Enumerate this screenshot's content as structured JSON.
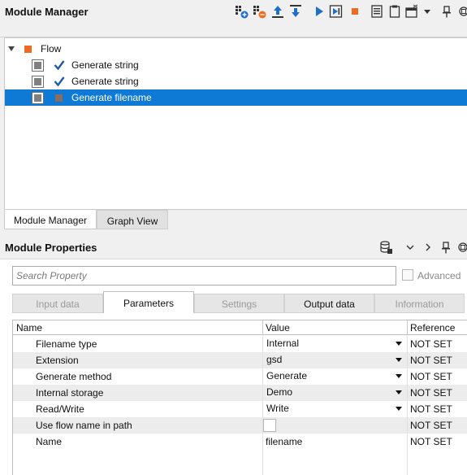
{
  "module_manager": {
    "title": "Module Manager",
    "toolbar_icons": [
      "add-module-icon",
      "remove-module-icon",
      "move-up-icon",
      "move-down-icon",
      "run-icon",
      "run-step-icon",
      "stop-icon",
      "list-icon",
      "clipboard-icon",
      "window-icon",
      "dropdown-icon",
      "pin-icon"
    ],
    "tree": {
      "root": {
        "label": "Flow",
        "color": "#ef6b22"
      },
      "items": [
        {
          "label": "Generate string",
          "status": "check"
        },
        {
          "label": "Generate string",
          "status": "check"
        },
        {
          "label": "Generate filename",
          "status": "square",
          "selected": true
        }
      ]
    },
    "tabs": [
      {
        "label": "Module Manager",
        "active": true
      },
      {
        "label": "Graph View",
        "active": false
      }
    ]
  },
  "module_properties": {
    "title": "Module Properties",
    "search": {
      "placeholder": "Search Property",
      "value": ""
    },
    "advanced_label": "Advanced",
    "tabs": [
      {
        "label": "Input data",
        "enabled": false
      },
      {
        "label": "Parameters",
        "active": true
      },
      {
        "label": "Settings",
        "enabled": false
      },
      {
        "label": "Output data",
        "enabled": true
      },
      {
        "label": "Information",
        "enabled": false
      }
    ],
    "columns": {
      "name": "Name",
      "value": "Value",
      "reference": "Reference"
    },
    "rows": [
      {
        "name": "Filename type",
        "value": "Internal",
        "dropdown": true,
        "reference": "NOT SET"
      },
      {
        "name": "Extension",
        "value": "gsd",
        "dropdown": true,
        "reference": "NOT SET"
      },
      {
        "name": "Generate method",
        "value": "Generate",
        "dropdown": true,
        "reference": "NOT SET"
      },
      {
        "name": "Internal storage",
        "value": "Demo",
        "dropdown": true,
        "reference": "NOT SET"
      },
      {
        "name": "Read/Write",
        "value": "Write",
        "dropdown": true,
        "reference": "NOT SET"
      },
      {
        "name": "Use flow name in path",
        "value": "",
        "checkbox": true,
        "reference": "NOT SET"
      },
      {
        "name": "Name",
        "value": "filename",
        "dropdown": false,
        "reference": "NOT SET"
      }
    ]
  },
  "colors": {
    "accent": "#0f7ad6",
    "flow": "#ef6b22",
    "run_blue": "#1e6fc8",
    "stop_orange": "#ef6b22"
  }
}
